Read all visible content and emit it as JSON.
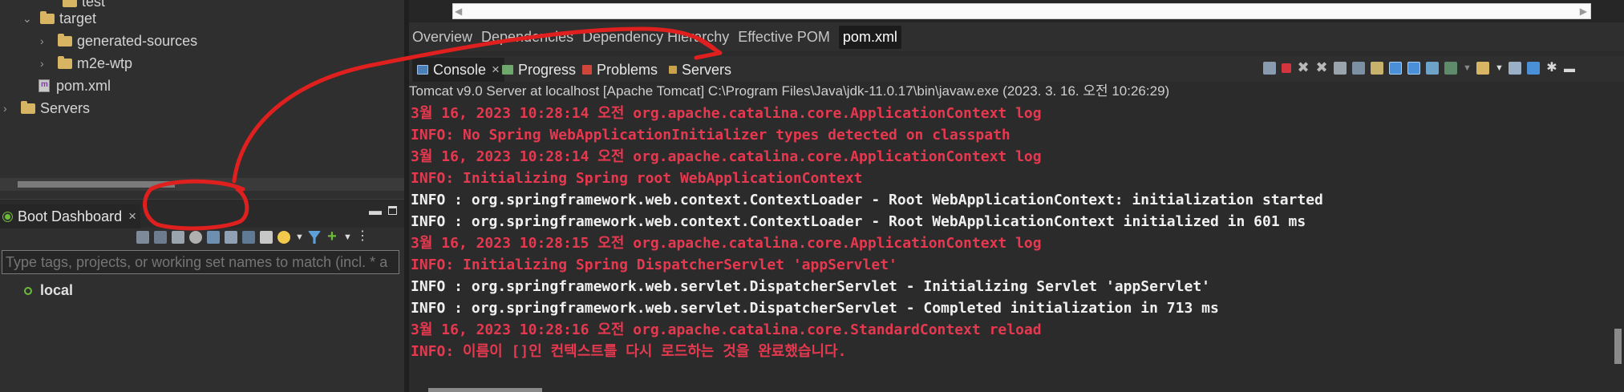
{
  "project_tree": {
    "items": [
      {
        "label": "test",
        "type": "folder",
        "depth": 3
      },
      {
        "label": "target",
        "type": "folder",
        "depth": 2
      },
      {
        "label": "generated-sources",
        "type": "folder",
        "depth": 3
      },
      {
        "label": "m2e-wtp",
        "type": "folder",
        "depth": 3
      },
      {
        "label": "pom.xml",
        "type": "file",
        "depth": 2
      },
      {
        "label": "Servers",
        "type": "folder",
        "depth": 0
      }
    ]
  },
  "boot_dashboard": {
    "tab_label": "Boot Dashboard",
    "close_glyph": "×",
    "search_placeholder": "Type tags, projects, or working set names to match (incl. * a",
    "local_label": "local"
  },
  "pom_editor": {
    "tabs": [
      "Overview",
      "Dependencies",
      "Dependency Hierarchy",
      "Effective POM",
      "pom.xml"
    ],
    "active_tab": "pom.xml"
  },
  "console": {
    "tabs": [
      {
        "label": "Console",
        "icon": "console-icon",
        "close": "×"
      },
      {
        "label": "Progress",
        "icon": "progress-icon"
      },
      {
        "label": "Problems",
        "icon": "problems-icon"
      },
      {
        "label": "Servers",
        "icon": "servers-icon"
      }
    ],
    "description": "Tomcat v9.0 Server at localhost [Apache Tomcat] C:\\Program Files\\Java\\jdk-11.0.17\\bin\\javaw.exe  (2023. 3. 16. 오전 10:26:29)",
    "lines": [
      {
        "text": "3월 16, 2023 10:28:14 오전 org.apache.catalina.core.ApplicationContext log",
        "level": "err"
      },
      {
        "text": "INFO: No Spring WebApplicationInitializer types detected on classpath",
        "level": "err"
      },
      {
        "text": "3월 16, 2023 10:28:14 오전 org.apache.catalina.core.ApplicationContext log",
        "level": "err"
      },
      {
        "text": "INFO: Initializing Spring root WebApplicationContext",
        "level": "err"
      },
      {
        "text": "INFO : org.springframework.web.context.ContextLoader - Root WebApplicationContext: initialization started",
        "level": "info"
      },
      {
        "text": "INFO : org.springframework.web.context.ContextLoader - Root WebApplicationContext initialized in 601 ms",
        "level": "info"
      },
      {
        "text": "3월 16, 2023 10:28:15 오전 org.apache.catalina.core.ApplicationContext log",
        "level": "err"
      },
      {
        "text": "INFO: Initializing Spring DispatcherServlet 'appServlet'",
        "level": "err"
      },
      {
        "text": "INFO : org.springframework.web.servlet.DispatcherServlet - Initializing Servlet 'appServlet'",
        "level": "info"
      },
      {
        "text": "INFO : org.springframework.web.servlet.DispatcherServlet - Completed initialization in 713 ms",
        "level": "info"
      },
      {
        "text": "3월 16, 2023 10:28:16 오전 org.apache.catalina.core.StandardContext reload",
        "level": "err"
      },
      {
        "text": "INFO: 이름이 []인 컨텍스트를 다시 로드하는 것을 완료했습니다.",
        "level": "err"
      }
    ]
  },
  "colors": {
    "error_text": "#e6384f",
    "info_text": "#f0f0f0",
    "annotation_red": "#e0201e",
    "boot_green": "#6dbb3a"
  }
}
